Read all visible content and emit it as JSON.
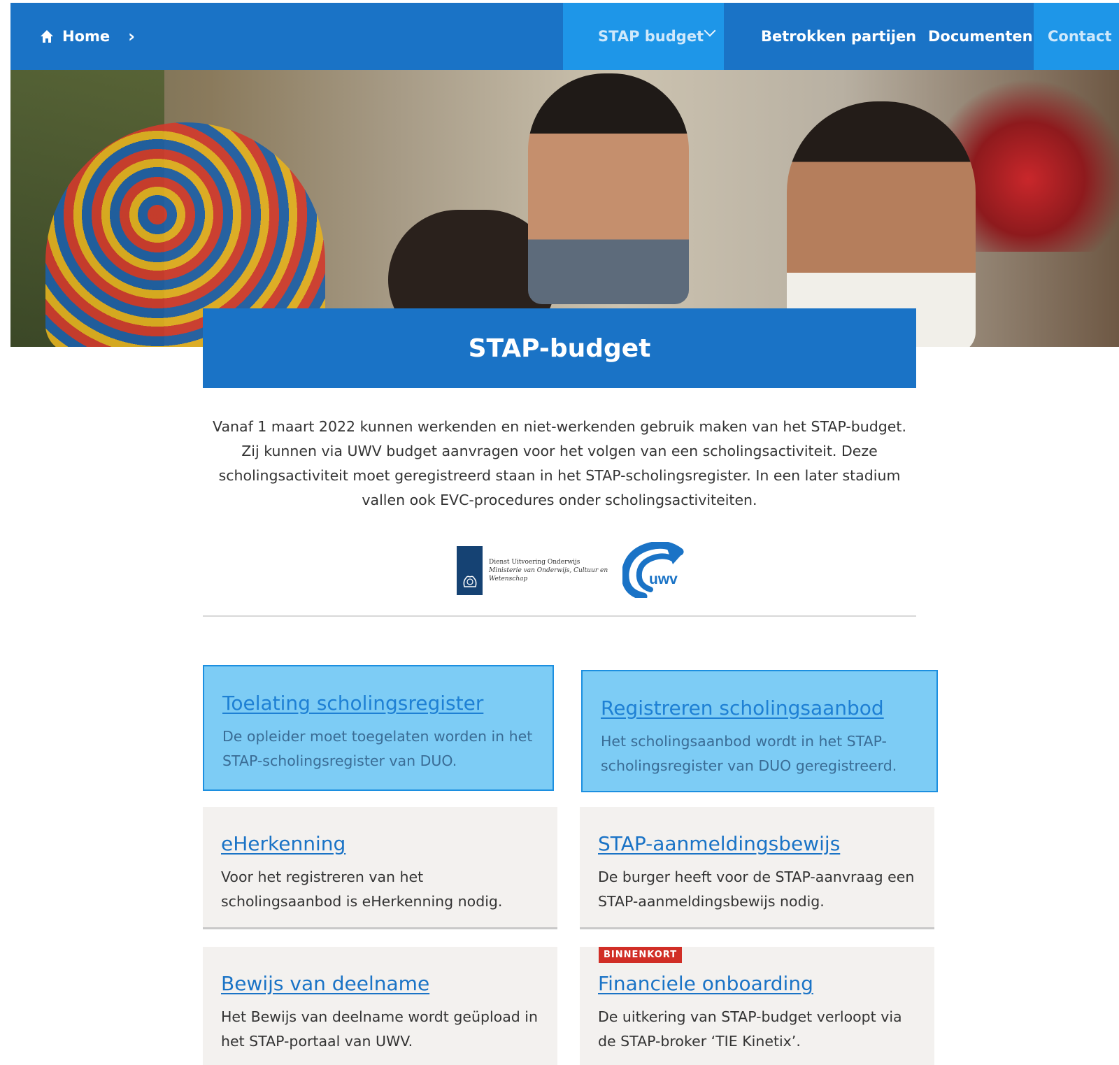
{
  "nav": {
    "home": "Home",
    "items": [
      "STAP budget",
      "Betrokken partijen",
      "Documenten",
      "Contact"
    ]
  },
  "hero": {
    "alt": "Studenten aan tafel"
  },
  "page": {
    "title": "STAP-budget",
    "intro": "Vanaf 1 maart 2022 kunnen werkenden en niet-werkenden gebruik maken van het STAP-budget. Zij kunnen via UWV budget aanvragen voor het volgen van een scholingsactiviteit. Deze scholingsactiviteit moet geregistreerd staan in het STAP-scholingsregister. In een later stadium vallen ook EVC-procedures onder scholingsactiviteiten."
  },
  "logos": {
    "duo_line1": "Dienst Uitvoering Onderwijs",
    "duo_line2": "Ministerie van Onderwijs, Cultuur en",
    "duo_line3": "Wetenschap",
    "uwv": "uwv"
  },
  "cards": [
    {
      "title": "Toelating scholingsregister",
      "desc": "De opleider moet toegelaten worden in het STAP-scholingsregister van DUO."
    },
    {
      "title": "Registreren scholingsaanbod",
      "desc": "Het scholingsaanbod wordt in het STAP-scholingsregister van DUO geregistreerd."
    },
    {
      "title": "eHerkenning",
      "desc": "Voor het registreren van het scholingsaanbod is eHerkenning nodig."
    },
    {
      "title": "STAP-aanmeldingsbewijs",
      "desc": "De burger heeft voor de STAP-aanvraag een STAP-aanmeldingsbewijs nodig."
    },
    {
      "title": "Bewijs van deelname",
      "desc": "Het Bewijs van deelname wordt geüpload in het STAP-portaal van UWV."
    },
    {
      "title": "Financiele onboarding",
      "desc": "De uitkering van STAP-budget verloopt via de STAP-broker ‘TIE Kinetix’.",
      "badge": "BINNENKORT"
    }
  ],
  "colors": {
    "primary": "#1a73c6",
    "highlight": "#7dccf5",
    "badge": "#d12e26"
  }
}
